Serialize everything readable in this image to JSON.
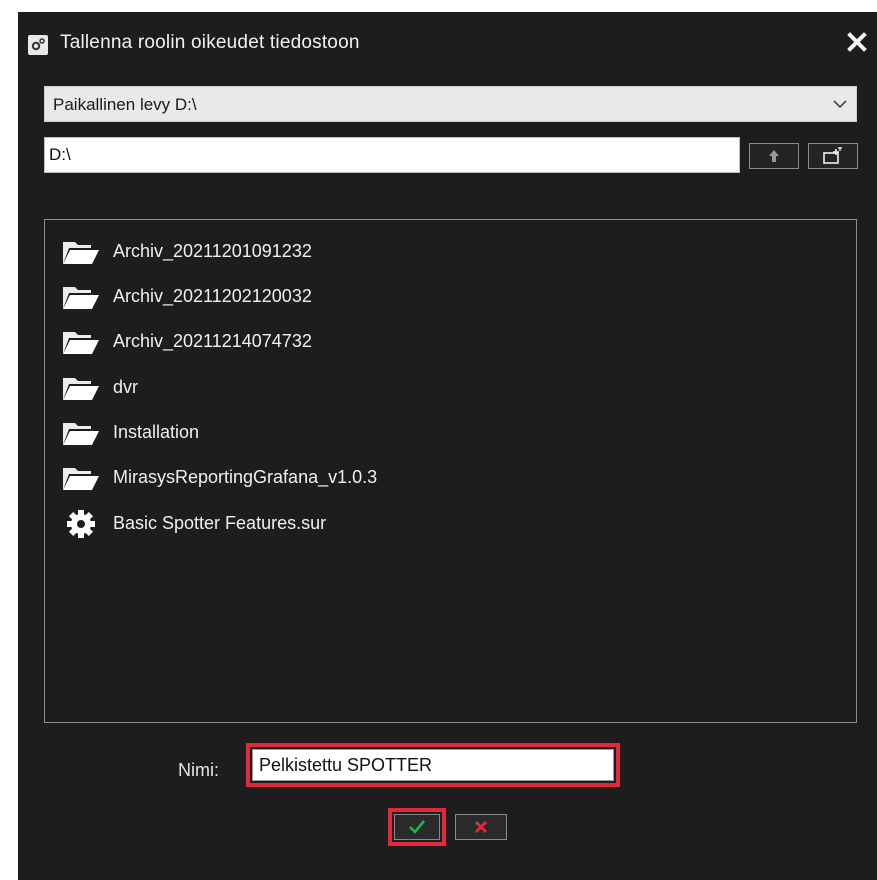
{
  "dialog": {
    "title": "Tallenna roolin oikeudet tiedostoon",
    "title_icon": "settings-gears-icon",
    "close_icon": "close-icon"
  },
  "drive": {
    "selected": "Paikallinen levy D:\\",
    "chevron_icon": "chevron-down-icon"
  },
  "path": {
    "value": "D:\\"
  },
  "toolbar": {
    "up_icon": "arrow-up-icon",
    "new_folder_icon": "new-folder-icon"
  },
  "files": [
    {
      "name": "Archiv_20211201091232",
      "icon": "folder-icon"
    },
    {
      "name": "Archiv_20211202120032",
      "icon": "folder-icon"
    },
    {
      "name": "Archiv_20211214074732",
      "icon": "folder-icon"
    },
    {
      "name": "dvr",
      "icon": "folder-icon"
    },
    {
      "name": "Installation",
      "icon": "folder-icon"
    },
    {
      "name": "MirasysReportingGrafana_v1.0.3",
      "icon": "folder-icon"
    },
    {
      "name": "Basic Spotter Features.sur",
      "icon": "gear-icon"
    }
  ],
  "name_field": {
    "label": "Nimi:",
    "value": "Pelkistettu SPOTTER"
  },
  "actions": {
    "ok_icon": "check-icon",
    "cancel_icon": "x-icon"
  },
  "colors": {
    "dialog_bg": "#1d1d1d",
    "highlight": "#e0293a",
    "ok_green": "#22b14c",
    "cancel_red": "#e0293a"
  }
}
